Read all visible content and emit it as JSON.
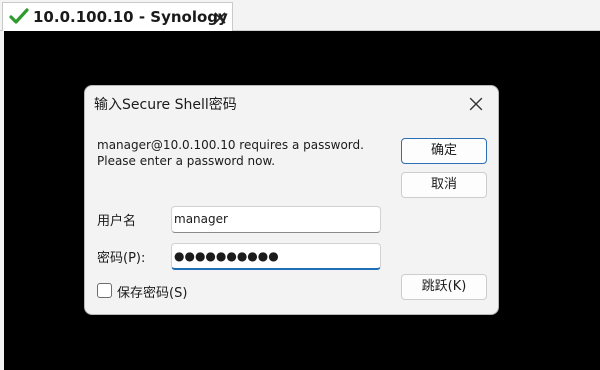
{
  "tab": {
    "title": "10.0.100.10 - Synology",
    "status_icon": "checkmark-icon",
    "status_color": "#2e9b2e"
  },
  "dialog": {
    "title": "输入Secure Shell密码",
    "message_line1": "manager@10.0.100.10 requires a password.",
    "message_line2": "Please enter a password now.",
    "username_label": "用户名",
    "username_value": "manager",
    "password_label": "密码(P):",
    "password_masked": "●●●●●●●●●●",
    "save_password_label": "保存密码(S)",
    "save_password_checked": false,
    "ok_label": "确定",
    "cancel_label": "取消",
    "skip_label": "跳跃(K)"
  },
  "colors": {
    "terminal_background": "#000000",
    "dialog_background": "#f3f3f3",
    "focus_accent": "#1f6fb6"
  }
}
